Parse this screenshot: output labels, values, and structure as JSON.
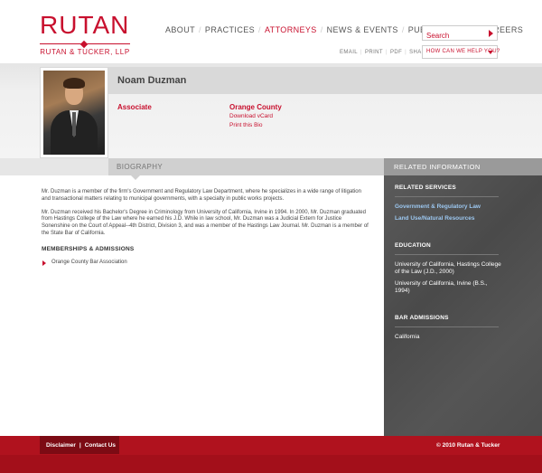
{
  "logo": {
    "main": "RUTAN",
    "sub": "RUTAN & TUCKER, LLP"
  },
  "nav": {
    "items": [
      {
        "label": "ABOUT",
        "active": false
      },
      {
        "label": "PRACTICES",
        "active": false
      },
      {
        "label": "ATTORNEYS",
        "active": true
      },
      {
        "label": "NEWS & EVENTS",
        "active": false
      },
      {
        "label": "PUBLICATIONS",
        "active": false
      },
      {
        "label": "CAREERS",
        "active": false
      }
    ],
    "separator": "/"
  },
  "search": {
    "placeholder": "Search"
  },
  "utility": {
    "items": [
      "EMAIL",
      "PRINT",
      "PDF",
      "SHARE"
    ],
    "separator": "|"
  },
  "help": {
    "label": "HOW CAN WE HELP YOU?"
  },
  "profile": {
    "name": "Noam Duzman",
    "title": "Associate",
    "office": "Orange County",
    "vcard_link": "Download vCard",
    "print_link": "Print this Bio"
  },
  "sections": {
    "biography": "BIOGRAPHY",
    "related": "RELATED INFORMATION"
  },
  "biography": {
    "paragraphs": [
      "Mr. Duzman is a member of the firm's Government and Regulatory Law Department, where he specializes in a wide range of litigation and transactional matters relating to municipal governments, with a specialty in public works projects.",
      "Mr. Duzman received his Bachelor's Degree in Criminology from University of California, Irvine in 1994. In 2000, Mr. Duzman graduated from Hastings College of the Law where he earned his J.D. While in law school, Mr. Duzman was a Judicial Extern for Justice Sonenshine on the Court of Appeal--4th District, Division 3, and was a member of the Hastings Law Journal. Mr. Duzman is a member of the State Bar of California."
    ],
    "memberships_heading": "MEMBERSHIPS & ADMISSIONS",
    "memberships": [
      "Orange County Bar Association"
    ]
  },
  "related": {
    "services_heading": "RELATED SERVICES",
    "services": [
      "Government & Regulatory Law",
      "Land Use/Natural Resources"
    ],
    "education_heading": "EDUCATION",
    "education": [
      "University of California, Hastings College of the Law (J.D., 2000)",
      "University of California, Irvine (B.S., 1994)"
    ],
    "bar_heading": "BAR ADMISSIONS",
    "bar": [
      "California"
    ]
  },
  "footer": {
    "disclaimer": "Disclaimer",
    "separator": "|",
    "contact": "Contact Us",
    "copyright": "© 2010 Rutan & Tucker"
  },
  "colors": {
    "brand_red": "#c8102e",
    "sidebar_gray": "#4f4f4f",
    "link_blue": "#9cc7f0"
  }
}
